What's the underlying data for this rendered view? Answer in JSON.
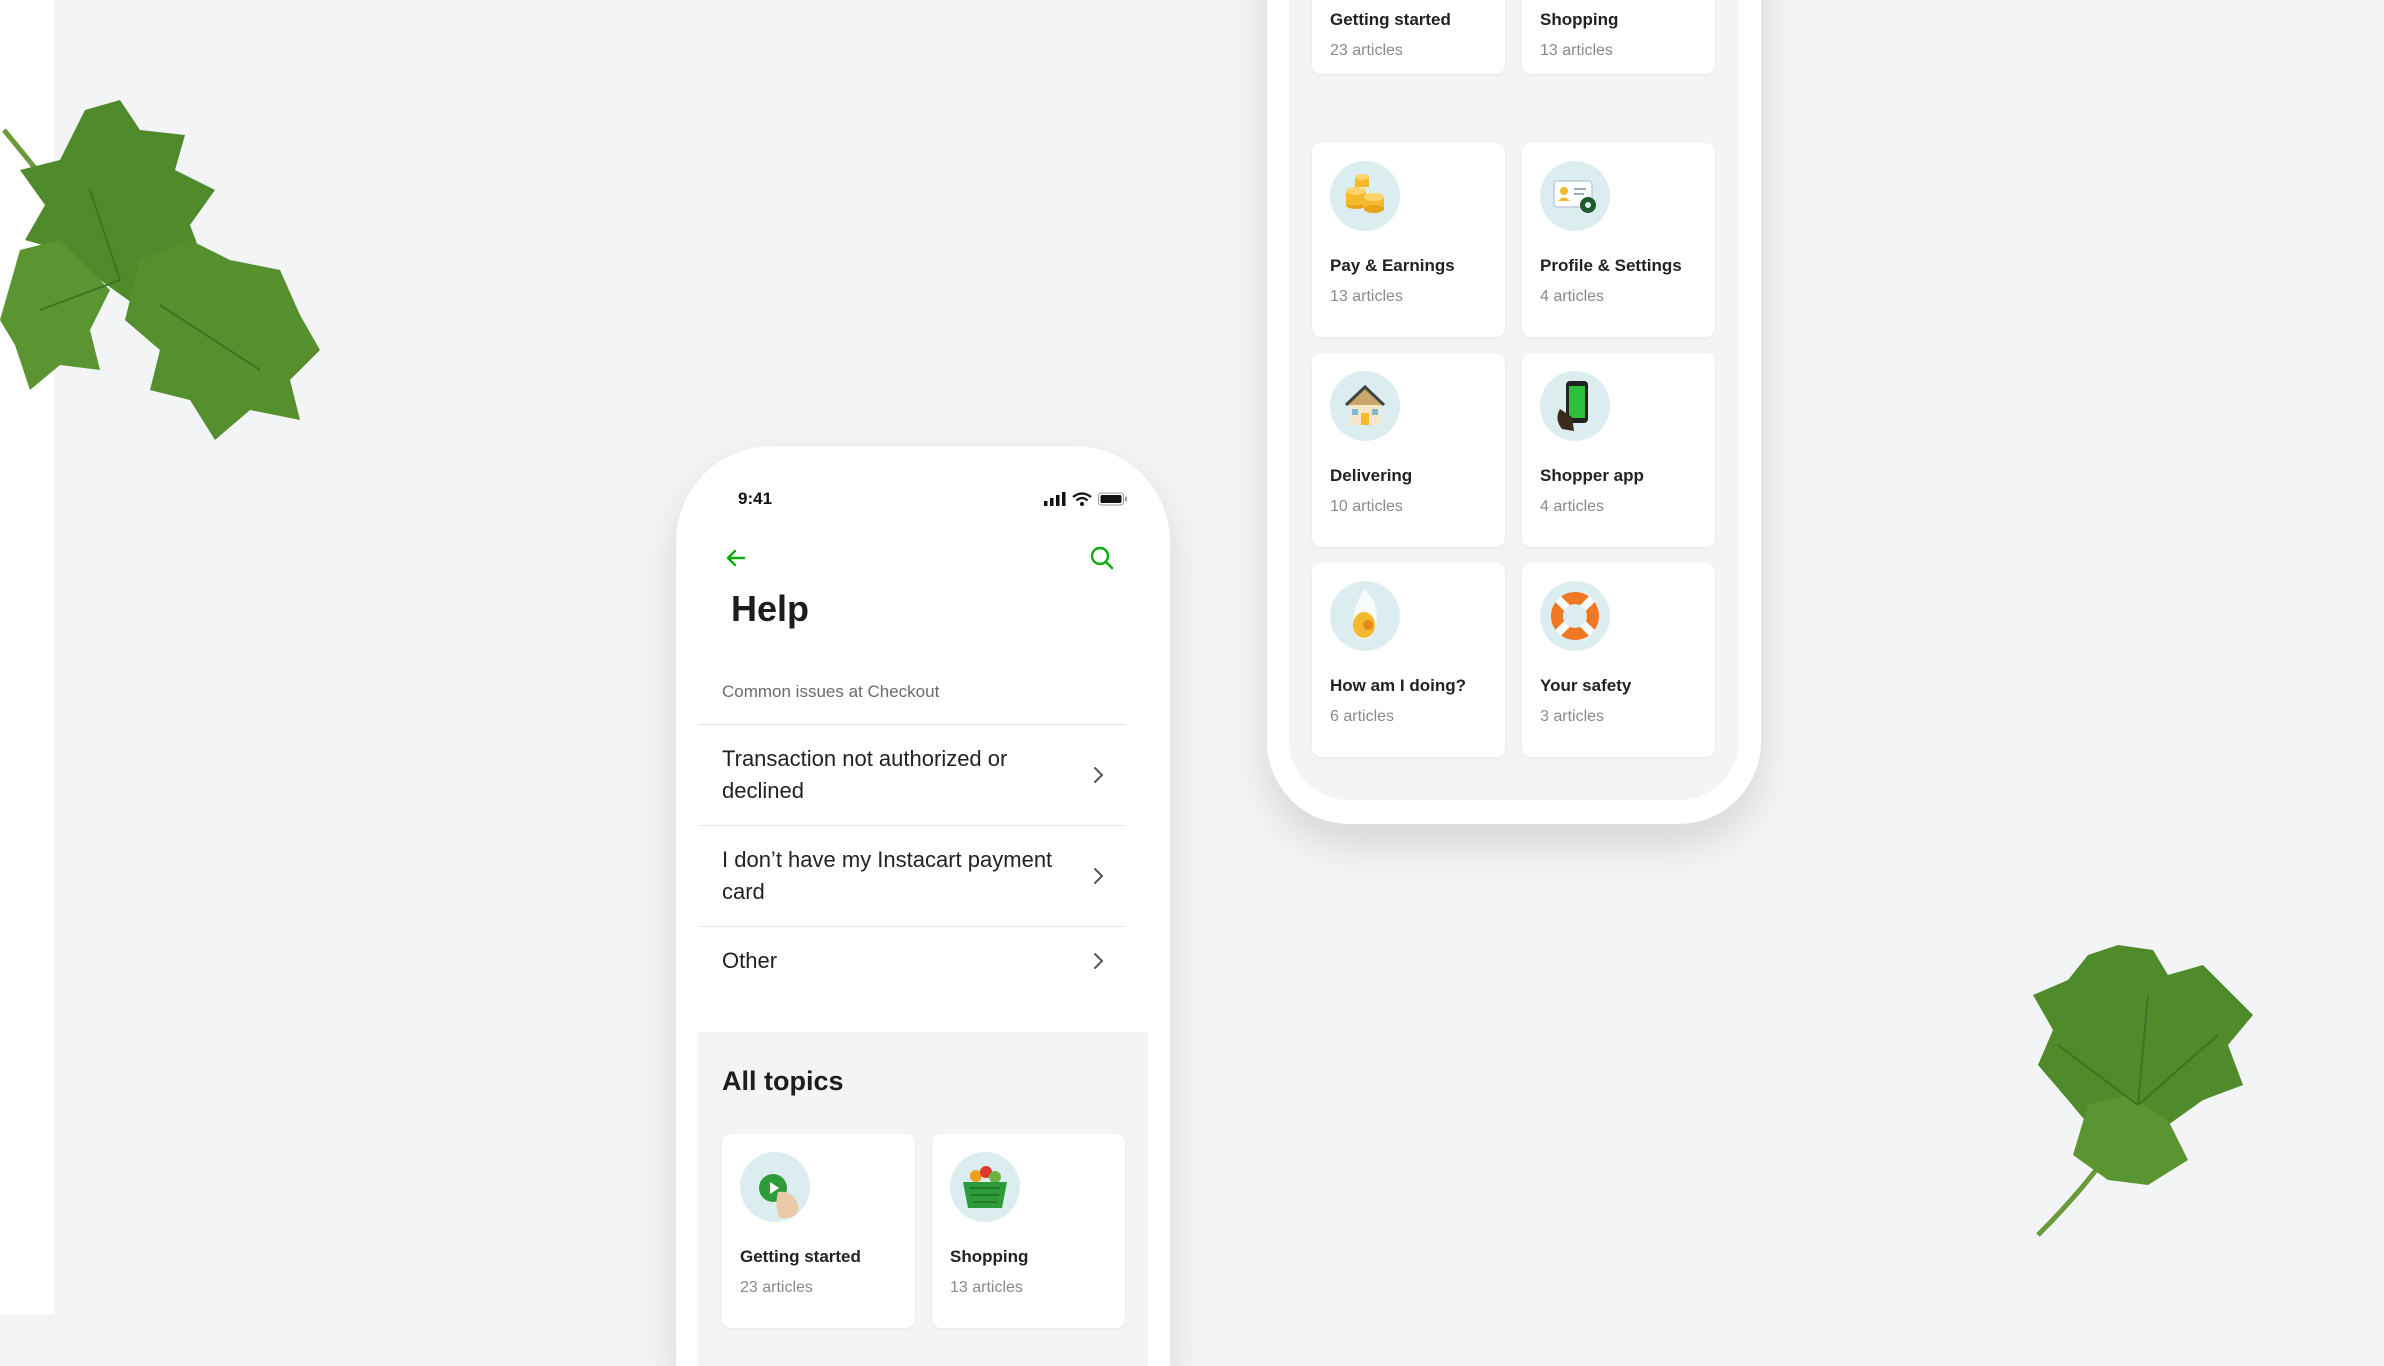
{
  "status_bar": {
    "time": "9:41"
  },
  "help_screen": {
    "title": "Help",
    "section_label": "Common issues at Checkout",
    "issues": [
      {
        "label": "Transaction not authorized or declined"
      },
      {
        "label": "I don’t have my Instacart payment card"
      },
      {
        "label": "Other"
      }
    ],
    "topics_title": "All topics",
    "topics": [
      {
        "name": "Getting started",
        "count": "23 articles",
        "icon": "getting-started-icon"
      },
      {
        "name": "Shopping",
        "count": "13 articles",
        "icon": "shopping-basket-icon"
      }
    ]
  },
  "topics_screen": {
    "topics": [
      {
        "name": "Getting started",
        "count": "23 articles",
        "icon": "getting-started-icon"
      },
      {
        "name": "Shopping",
        "count": "13 articles",
        "icon": "shopping-basket-icon"
      },
      {
        "name": "Pay & Earnings",
        "count": "13 articles",
        "icon": "coins-icon"
      },
      {
        "name": "Profile & Settings",
        "count": "4 articles",
        "icon": "profile-settings-icon"
      },
      {
        "name": "Delivering",
        "count": "10 articles",
        "icon": "house-icon"
      },
      {
        "name": "Shopper app",
        "count": "4 articles",
        "icon": "phone-app-icon"
      },
      {
        "name": "How am I doing?",
        "count": "6 articles",
        "icon": "egg-timer-icon"
      },
      {
        "name": "Your safety",
        "count": "3 articles",
        "icon": "lifebuoy-icon"
      }
    ]
  },
  "colors": {
    "accent": "#0aad0a",
    "background": "#f3f4f6",
    "card": "#ffffff",
    "icon_circle": "#dcedf0"
  }
}
